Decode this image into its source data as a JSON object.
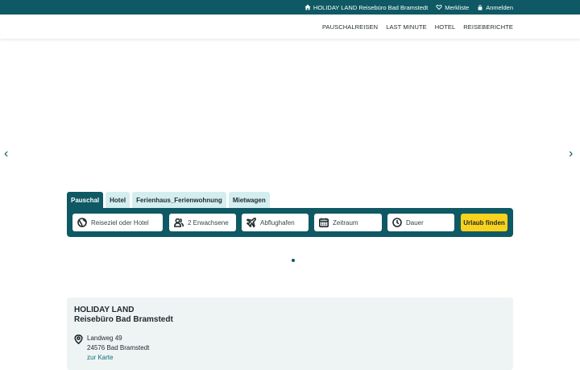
{
  "topbar": {
    "agency": {
      "label": "HOLIDAY LAND Reisebüro Bad Bramstedt",
      "icon": "home-icon"
    },
    "wishlist": {
      "label": "Merkliste",
      "icon": "heart-icon"
    },
    "login": {
      "label": "Anmelden",
      "icon": "lock-icon"
    }
  },
  "nav": {
    "items": [
      "PAUSCHALREISEN",
      "LAST MINUTE",
      "HOTEL",
      "REISEBERICHTE"
    ]
  },
  "slider": {
    "prev": "‹",
    "next": "›"
  },
  "search": {
    "tabs": [
      "Pauschal",
      "Hotel",
      "Ferienhaus_Ferienwohnung",
      "Mietwagen"
    ],
    "active_tab": "Pauschal",
    "fields": {
      "destination": "Reiseziel oder Hotel",
      "travellers": "2 Erwachsene",
      "airport": "Abflughafen",
      "period": "Zeitraum",
      "duration": "Dauer"
    },
    "submit": "Urlaub finden"
  },
  "agency_card": {
    "name_line1": "HOLIDAY LAND",
    "name_line2": "Reisebüro Bad Bramstedt",
    "street": "Landweg 49",
    "city": "24576  Bad Bramstedt",
    "map_link": "zur Karte"
  },
  "colors": {
    "brand": "#0e5963",
    "accent": "#f8d21c",
    "tab_inactive": "#d4eef0",
    "card_bg": "#eef3f4"
  }
}
